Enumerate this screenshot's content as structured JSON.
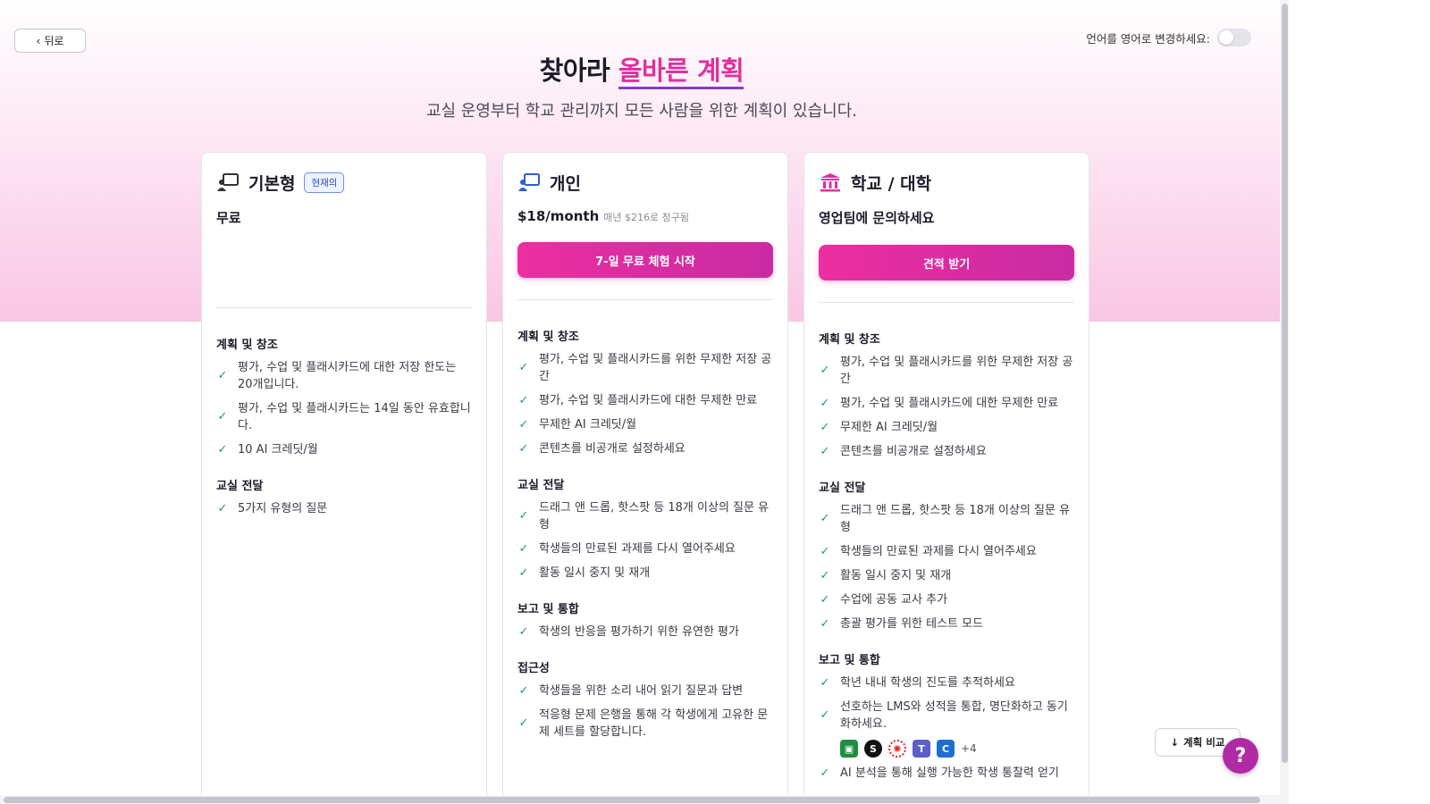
{
  "header": {
    "back_label": "뒤로",
    "lang_toggle_label": "언어를 영어로 변경하세요:",
    "title_part1": "찾아라 ",
    "title_highlight": "올바른 계획",
    "subtitle": "교실 운영부터 학교 관리까지 모든 사람을 위한 계획이 있습니다."
  },
  "colors": {
    "accent": "#e0309e",
    "cta_gradient_start": "#ec2ea0",
    "cta_gradient_end": "#c92ba3",
    "check": "#1f9d55",
    "help_button": "#b02aa6"
  },
  "plans": [
    {
      "name": "기본형",
      "badge": "현재의",
      "price": "무료",
      "icon": "teacher-board-icon",
      "sections": [
        {
          "title": "계획 및 창조",
          "features": [
            "평가, 수업 및 플래시카드에 대한 저장 한도는 20개입니다.",
            "평가, 수업 및 플래시카드는 14일 동안 유효합니다.",
            "10 AI 크레딧/월"
          ]
        },
        {
          "title": "교실 전달",
          "features": [
            "5가지 유형의 질문"
          ]
        }
      ]
    },
    {
      "name": "개인",
      "price": "$18/month",
      "price_note": "매년 $216로 청구됨",
      "cta": "7-일 무료 체험 시작",
      "icon": "teacher-board-blue-icon",
      "sections": [
        {
          "title": "계획 및 창조",
          "features": [
            "평가, 수업 및 플래시카드를 위한 무제한 저장 공간",
            "평가, 수업 및 플래시카드에 대한 무제한 만료",
            "무제한 AI 크레딧/월",
            "콘텐츠를 비공개로 설정하세요"
          ]
        },
        {
          "title": "교실 전달",
          "features": [
            "드래그 앤 드롭, 핫스팟 등 18개 이상의 질문 유형",
            "학생들의 만료된 과제를 다시 열어주세요",
            "활동 일시 중지 및 재개"
          ]
        },
        {
          "title": "보고 및 통합",
          "features": [
            "학생의 반응을 평가하기 위한 유연한 평가"
          ]
        },
        {
          "title": "접근성",
          "features": [
            "학생들을 위한 소리 내어 읽기 질문과 답변",
            "적응형 문제 은행을 통해 각 학생에게 고유한 문제 세트를 할당합니다."
          ]
        }
      ]
    },
    {
      "name": "학교 / 대학",
      "price": "영업팀에 문의하세요",
      "cta": "견적 받기",
      "icon": "institution-icon",
      "sections": [
        {
          "title": "계획 및 창조",
          "features": [
            "평가, 수업 및 플래시카드를 위한 무제한 저장 공간",
            "평가, 수업 및 플래시카드에 대한 무제한 만료",
            "무제한 AI 크레딧/월",
            "콘텐츠를 비공개로 설정하세요"
          ]
        },
        {
          "title": "교실 전달",
          "features": [
            "드래그 앤 드롭, 핫스팟 등 18개 이상의 질문 유형",
            "학생들의 만료된 과제를 다시 열어주세요",
            "활동 일시 중지 및 재개",
            "수업에 공동 교사 추가",
            "총괄 평가를 위한 테스트 모드"
          ]
        },
        {
          "title": "보고 및 통합",
          "features": [
            "학년 내내 학생의 진도를 추적하세요",
            "선호하는 LMS와 성적을 통합, 명단화하고 동기화하세요.",
            "AI 분석을 통해 실행 가능한 학생 통찰력 얻기"
          ],
          "integrations_more": "+4"
        }
      ]
    }
  ],
  "footer": {
    "compare_label": "계획 비교",
    "help_label": "?"
  }
}
